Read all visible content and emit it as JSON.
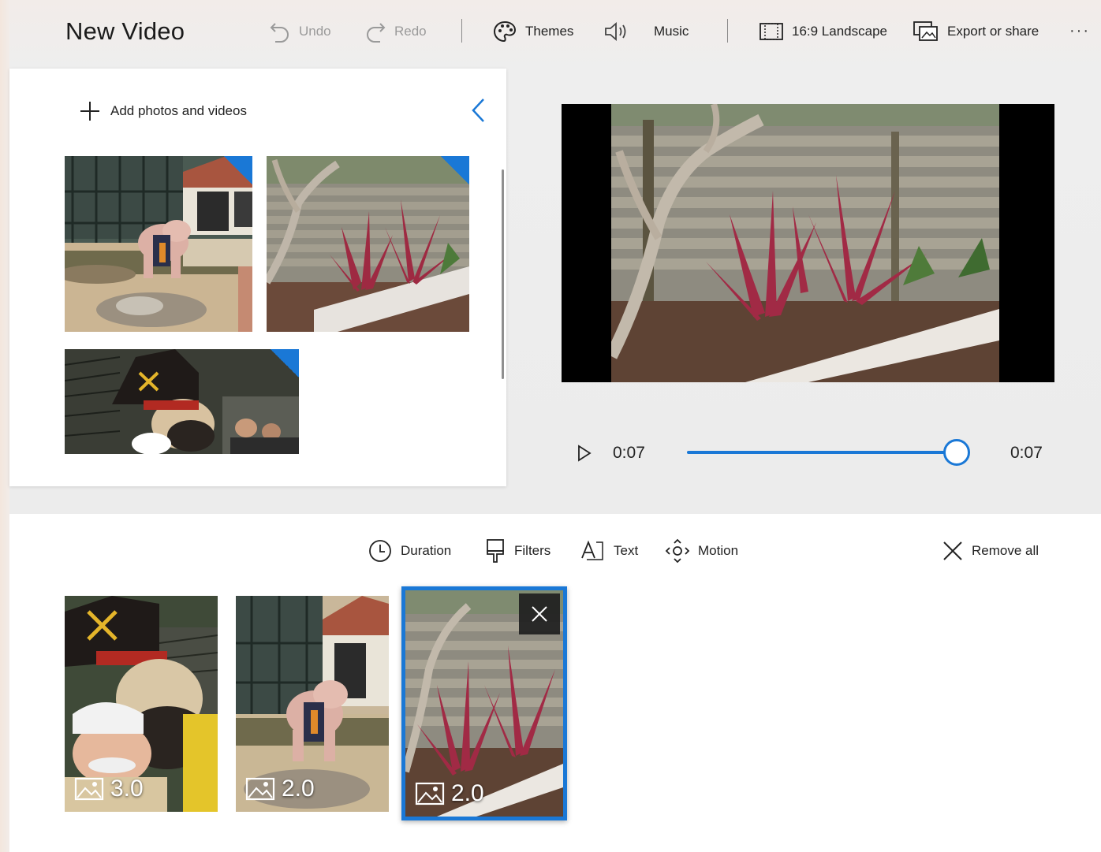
{
  "app": {
    "title": "New Video"
  },
  "toolbar": {
    "undo": "Undo",
    "redo": "Redo",
    "themes": "Themes",
    "music": "Music",
    "aspect": "16:9 Landscape",
    "export": "Export or share",
    "more": "···"
  },
  "library": {
    "add_label": "Add photos and videos",
    "items": [
      {
        "subject": "pig-statue-patio",
        "used": true
      },
      {
        "subject": "ti-plants-fence",
        "used": true
      },
      {
        "subject": "pirate-mascot-stadium",
        "used": true
      }
    ]
  },
  "player": {
    "current_time": "0:07",
    "total_time": "0:07",
    "progress": 1.0
  },
  "storyboard": {
    "duration_label": "Duration",
    "filters_label": "Filters",
    "text_label": "Text",
    "motion_label": "Motion",
    "remove_all_label": "Remove all",
    "cards": [
      {
        "duration": "3.0",
        "subject": "pirate-mascot-selfie",
        "selected": false
      },
      {
        "duration": "2.0",
        "subject": "pig-statue-patio",
        "selected": false
      },
      {
        "duration": "2.0",
        "subject": "ti-plants-fence",
        "selected": true
      }
    ]
  },
  "colors": {
    "accent": "#1a78d6",
    "panel": "#ffffff",
    "background": "#ececec"
  }
}
